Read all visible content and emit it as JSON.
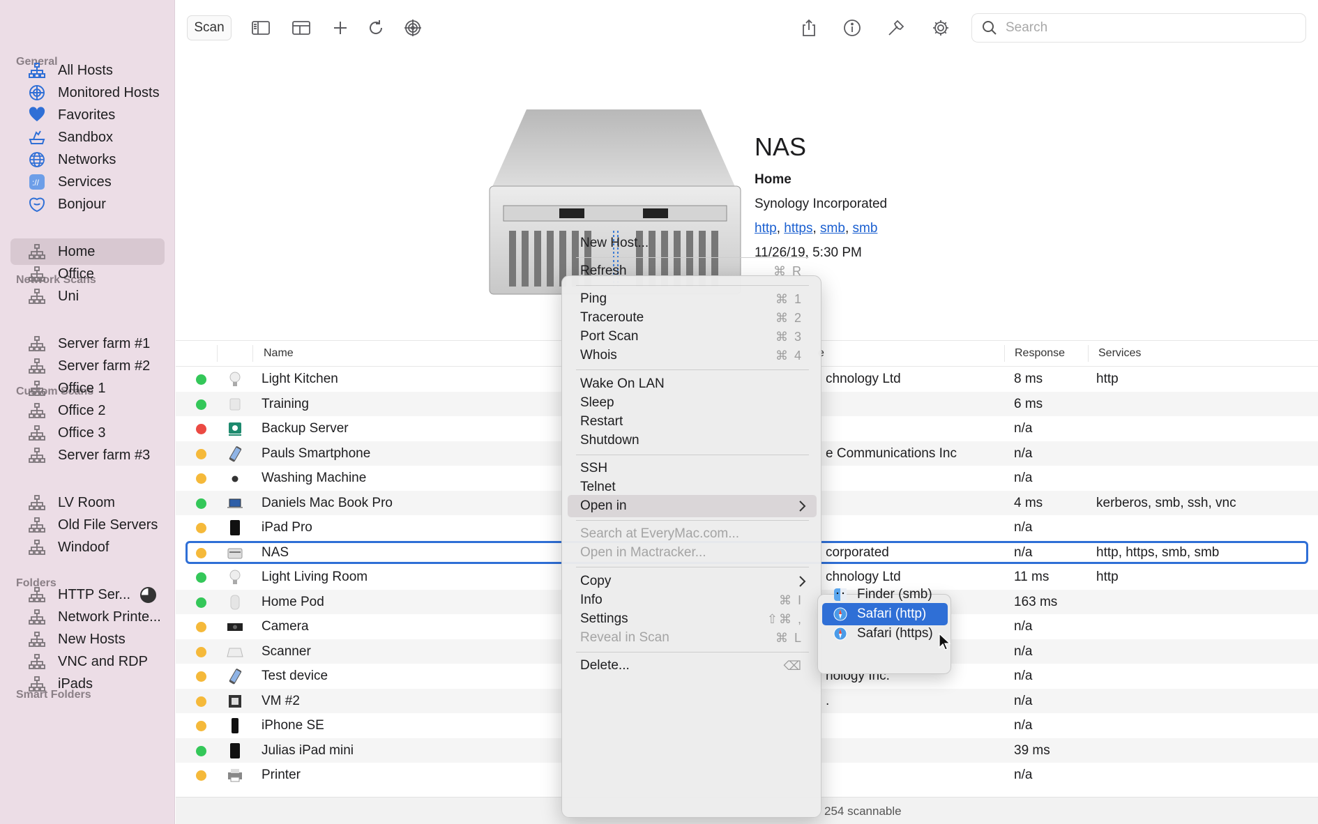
{
  "sidebar": {
    "sections": [
      {
        "label": "General"
      },
      {
        "label": "Network Scans"
      },
      {
        "label": "Custom Scans"
      },
      {
        "label": "Folders"
      },
      {
        "label": "Smart Folders"
      }
    ],
    "items": [
      {
        "label": "All Hosts",
        "icon": "all-hosts-icon"
      },
      {
        "label": "Monitored Hosts",
        "icon": "monitored-hosts-icon"
      },
      {
        "label": "Favorites",
        "icon": "heart-icon"
      },
      {
        "label": "Sandbox",
        "icon": "sandbox-icon"
      },
      {
        "label": "Networks",
        "icon": "globe-icon"
      },
      {
        "label": "Services",
        "icon": "services-icon"
      },
      {
        "label": "Bonjour",
        "icon": "bonjour-icon"
      },
      {
        "label": "Home",
        "icon": "network-icon"
      },
      {
        "label": "Office",
        "icon": "network-icon"
      },
      {
        "label": "Uni",
        "icon": "network-icon"
      },
      {
        "label": "Server farm #1",
        "icon": "network-icon"
      },
      {
        "label": "Server farm #2",
        "icon": "network-icon"
      },
      {
        "label": "Office 1",
        "icon": "network-icon"
      },
      {
        "label": "Office 2",
        "icon": "network-icon"
      },
      {
        "label": "Office 3",
        "icon": "network-icon"
      },
      {
        "label": "Server farm #3",
        "icon": "network-icon"
      },
      {
        "label": "LV Room",
        "icon": "network-icon"
      },
      {
        "label": "Old File Servers",
        "icon": "network-icon"
      },
      {
        "label": "Windoof",
        "icon": "network-icon"
      },
      {
        "label": "HTTP Ser...",
        "icon": "network-icon"
      },
      {
        "label": "Network Printe...",
        "icon": "network-icon"
      },
      {
        "label": "New Hosts",
        "icon": "network-icon"
      },
      {
        "label": "VNC and RDP",
        "icon": "network-icon"
      },
      {
        "label": "iPads",
        "icon": "network-icon"
      }
    ],
    "selected": "Home"
  },
  "toolbar": {
    "scan_label": "Scan",
    "search_placeholder": "Search"
  },
  "detail": {
    "name": "NAS",
    "group": "Home",
    "vendor": "Synology Incorporated",
    "services": [
      "http",
      "https",
      "smb",
      "smb"
    ],
    "date": "11/26/19, 5:30 PM"
  },
  "table": {
    "columns": {
      "name": "Name",
      "vendor_partial": "e",
      "response": "Response",
      "services": "Services"
    },
    "rows": [
      {
        "status": "green",
        "icon": "lightbulb-icon",
        "name": "Light Kitchen",
        "vendor": "chnology Ltd",
        "response": "8 ms",
        "services": "http"
      },
      {
        "status": "green",
        "icon": "device-icon",
        "name": "Training",
        "vendor": "",
        "response": "6 ms",
        "services": ""
      },
      {
        "status": "red",
        "icon": "server-icon",
        "name": "Backup Server",
        "vendor": "",
        "response": "n/a",
        "services": ""
      },
      {
        "status": "orange",
        "icon": "smartphone-icon",
        "name": "Pauls Smartphone",
        "vendor": "e Communications Inc",
        "response": "n/a",
        "services": ""
      },
      {
        "status": "orange",
        "icon": "washing-machine-icon",
        "name": "Washing Machine",
        "vendor": "",
        "response": "n/a",
        "services": ""
      },
      {
        "status": "green",
        "icon": "laptop-icon",
        "name": "Daniels Mac Book Pro",
        "vendor": "",
        "response": "4 ms",
        "services": "kerberos, smb, ssh, vnc"
      },
      {
        "status": "orange",
        "icon": "tablet-icon",
        "name": "iPad Pro",
        "vendor": "",
        "response": "n/a",
        "services": ""
      },
      {
        "status": "orange",
        "icon": "nas-icon",
        "name": "NAS",
        "vendor": "corporated",
        "response": "n/a",
        "services": "http, https, smb, smb"
      },
      {
        "status": "green",
        "icon": "lightbulb-icon",
        "name": "Light Living Room",
        "vendor": "chnology Ltd",
        "response": "11 ms",
        "services": "http"
      },
      {
        "status": "green",
        "icon": "speaker-icon",
        "name": "Home Pod",
        "vendor": "",
        "response": "163 ms",
        "services": ""
      },
      {
        "status": "orange",
        "icon": "camera-icon",
        "name": "Camera",
        "vendor": "",
        "response": "n/a",
        "services": ""
      },
      {
        "status": "orange",
        "icon": "scanner-icon",
        "name": "Scanner",
        "vendor": "",
        "response": "n/a",
        "services": ""
      },
      {
        "status": "orange",
        "icon": "smartphone-icon",
        "name": "Test device",
        "vendor": "nology Inc.",
        "response": "n/a",
        "services": ""
      },
      {
        "status": "orange",
        "icon": "vm-icon",
        "name": "VM #2",
        "vendor": ".",
        "response": "n/a",
        "services": ""
      },
      {
        "status": "orange",
        "icon": "phone-icon",
        "name": "iPhone SE",
        "vendor": "",
        "response": "n/a",
        "services": ""
      },
      {
        "status": "green",
        "icon": "tablet-icon",
        "name": "Julias iPad mini",
        "vendor": "",
        "response": "39 ms",
        "services": ""
      },
      {
        "status": "orange",
        "icon": "printer-icon",
        "name": "Printer",
        "vendor": "",
        "response": "n/a",
        "services": ""
      }
    ],
    "selected_row": "NAS"
  },
  "status_bar": {
    "text": "254 scannable"
  },
  "context_menu": {
    "items": [
      {
        "label": "New Host...",
        "shortcut": ""
      },
      {
        "label": "Refresh",
        "shortcut": "⌘ R"
      },
      {
        "label": "Ping",
        "shortcut": "⌘ 1"
      },
      {
        "label": "Traceroute",
        "shortcut": "⌘ 2"
      },
      {
        "label": "Port Scan",
        "shortcut": "⌘ 3"
      },
      {
        "label": "Whois",
        "shortcut": "⌘ 4"
      },
      {
        "label": "Wake On LAN",
        "shortcut": ""
      },
      {
        "label": "Sleep",
        "shortcut": ""
      },
      {
        "label": "Restart",
        "shortcut": ""
      },
      {
        "label": "Shutdown",
        "shortcut": ""
      },
      {
        "label": "SSH",
        "shortcut": ""
      },
      {
        "label": "Telnet",
        "shortcut": ""
      },
      {
        "label": "Open in",
        "shortcut": "",
        "submenu": true
      },
      {
        "label": "Search at EveryMac.com...",
        "shortcut": "",
        "disabled": true
      },
      {
        "label": "Open in Mactracker...",
        "shortcut": "",
        "disabled": true
      },
      {
        "label": "Copy",
        "shortcut": "",
        "submenu": true
      },
      {
        "label": "Info",
        "shortcut": "⌘ I"
      },
      {
        "label": "Settings",
        "shortcut": "⇧⌘ ,"
      },
      {
        "label": "Reveal in Scan",
        "shortcut": "⌘ L",
        "disabled": true
      },
      {
        "label": "Delete...",
        "shortcut": "⌫"
      }
    ]
  },
  "submenu": {
    "items": [
      {
        "label": "Finder (smb)",
        "icon": "finder-icon"
      },
      {
        "label": "Safari (http)",
        "icon": "safari-icon",
        "highlighted": true
      },
      {
        "label": "Safari (https)",
        "icon": "safari-icon"
      }
    ]
  },
  "colors": {
    "sidebar_bg": "#ecdde6",
    "accent": "#2f6fd6",
    "status_green": "#34c759",
    "status_orange": "#f5b93a",
    "status_red": "#eb4a43",
    "icon_blue": "#2f6fd6"
  }
}
